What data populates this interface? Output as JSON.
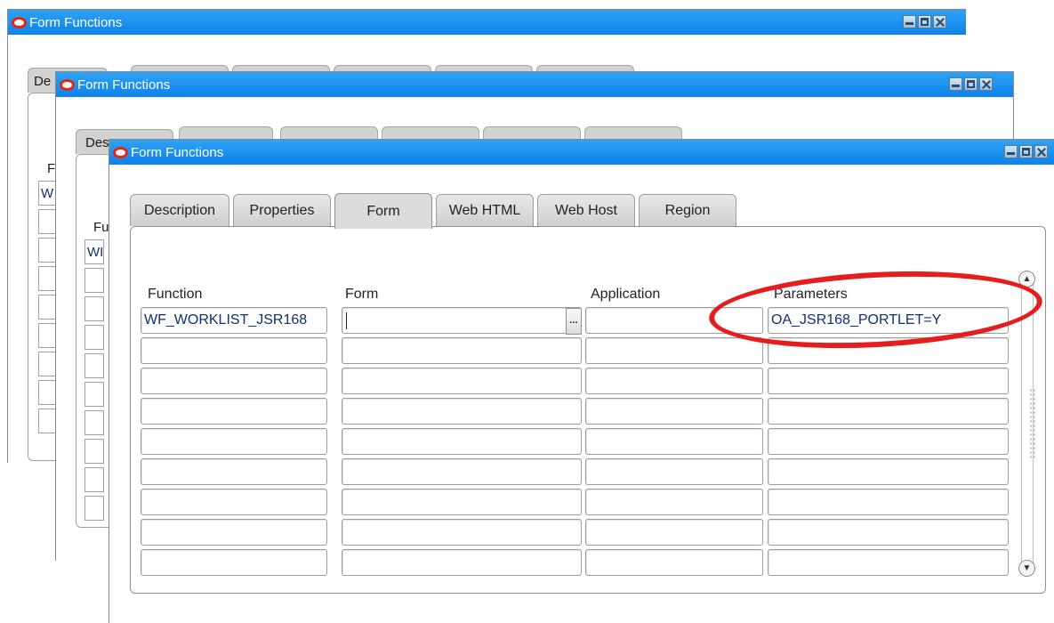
{
  "windows": {
    "back2": {
      "title": "Form Functions",
      "tab_fragment": "De",
      "label_fragment": "F",
      "value_fragment": "W"
    },
    "back1": {
      "title": "Form Functions",
      "tab_fragment": "Des",
      "label_fragment": "Fu",
      "value_fragment": "WI"
    },
    "front": {
      "title": "Form Functions"
    }
  },
  "tabs": [
    {
      "label": "Description",
      "active": false
    },
    {
      "label": "Properties",
      "active": false
    },
    {
      "label": "Form",
      "active": true
    },
    {
      "label": "Web HTML",
      "active": false
    },
    {
      "label": "Web Host",
      "active": false
    },
    {
      "label": "Region",
      "active": false
    }
  ],
  "columns": {
    "function": "Function",
    "form": "Form",
    "application": "Application",
    "parameters": "Parameters"
  },
  "rows": [
    {
      "function": "WF_WORKLIST_JSR168",
      "form": "",
      "application": "",
      "parameters": "OA_JSR168_PORTLET=Y"
    },
    {
      "function": "",
      "form": "",
      "application": "",
      "parameters": ""
    },
    {
      "function": "",
      "form": "",
      "application": "",
      "parameters": ""
    },
    {
      "function": "",
      "form": "",
      "application": "",
      "parameters": ""
    },
    {
      "function": "",
      "form": "",
      "application": "",
      "parameters": ""
    },
    {
      "function": "",
      "form": "",
      "application": "",
      "parameters": ""
    },
    {
      "function": "",
      "form": "",
      "application": "",
      "parameters": ""
    },
    {
      "function": "",
      "form": "",
      "application": "",
      "parameters": ""
    },
    {
      "function": "",
      "form": "",
      "application": "",
      "parameters": ""
    }
  ],
  "lov_button": "...",
  "icons": {
    "window_logo": "oracle-logo-icon",
    "minimize": "minimize-icon",
    "maximize": "maximize-icon",
    "close": "close-icon",
    "scroll_up": "scroll-up-icon",
    "scroll_down": "scroll-down-icon"
  },
  "colors": {
    "titlebar": "#1a8ff0",
    "annotation": "#e61d1d",
    "field_text": "#10306e"
  }
}
